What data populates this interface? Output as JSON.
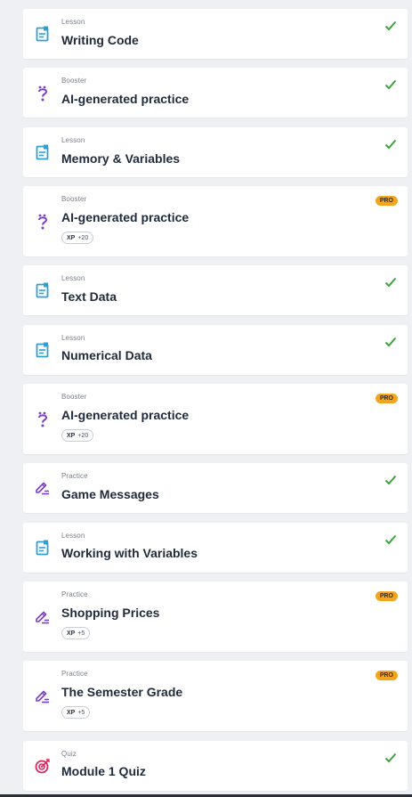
{
  "colors": {
    "check": "#3aa63a",
    "lesson_icon": "#2f9fd8",
    "booster_icon": "#7b3fc4",
    "practice_icon": "#7b3fc4",
    "quiz_icon": "#e0245e",
    "pro_badge": "#f3a51d"
  },
  "items": [
    {
      "type": "Lesson",
      "title": "Writing Code",
      "icon": "lesson-icon",
      "status": "completed"
    },
    {
      "type": "Booster",
      "title": "AI-generated practice",
      "icon": "booster-icon",
      "status": "completed"
    },
    {
      "type": "Lesson",
      "title": "Memory & Variables",
      "icon": "lesson-icon",
      "status": "completed"
    },
    {
      "type": "Booster",
      "title": "AI-generated practice",
      "icon": "booster-icon",
      "status": "pro",
      "pro_label": "PRO",
      "xp_label": "XP",
      "xp_value": "+20"
    },
    {
      "type": "Lesson",
      "title": "Text Data",
      "icon": "lesson-icon",
      "status": "completed"
    },
    {
      "type": "Lesson",
      "title": "Numerical Data",
      "icon": "lesson-icon",
      "status": "completed"
    },
    {
      "type": "Booster",
      "title": "AI-generated practice",
      "icon": "booster-icon",
      "status": "pro",
      "pro_label": "PRO",
      "xp_label": "XP",
      "xp_value": "+20"
    },
    {
      "type": "Practice",
      "title": "Game Messages",
      "icon": "practice-icon",
      "status": "completed"
    },
    {
      "type": "Lesson",
      "title": "Working with Variables",
      "icon": "lesson-icon",
      "status": "completed"
    },
    {
      "type": "Practice",
      "title": "Shopping Prices",
      "icon": "practice-icon",
      "status": "pro",
      "pro_label": "PRO",
      "xp_label": "XP",
      "xp_value": "+5"
    },
    {
      "type": "Practice",
      "title": "The Semester Grade",
      "icon": "practice-icon",
      "status": "pro",
      "pro_label": "PRO",
      "xp_label": "XP",
      "xp_value": "+5"
    },
    {
      "type": "Quiz",
      "title": "Module 1 Quiz",
      "icon": "quiz-icon",
      "status": "completed"
    }
  ]
}
